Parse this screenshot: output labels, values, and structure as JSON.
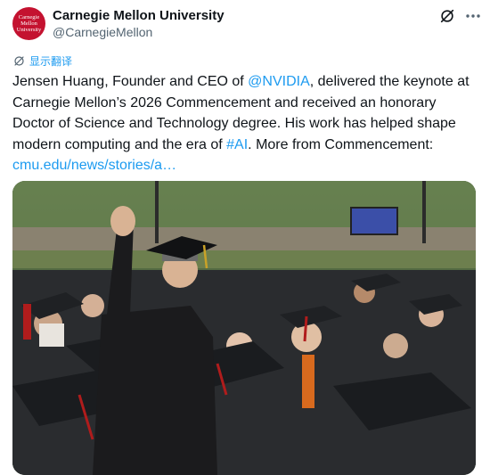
{
  "account": {
    "avatar_lines": [
      "Carnegie",
      "Mellon",
      "University"
    ],
    "display_name": "Carnegie Mellon University",
    "handle": "@CarnegieMellon"
  },
  "translate": {
    "label": "显示翻译"
  },
  "tweet": {
    "seg1": "Jensen Huang, Founder and CEO of ",
    "mention": "@NVIDIA",
    "seg2": ", delivered the keynote at Carnegie Mellon’s 2026 Commencement and received an honorary Doctor of Science and Technology degree. His work has helped shape modern computing and the era of ",
    "hashtag": "#AI",
    "seg3": ". More from Commencement:",
    "link": "cmu.edu/news/stories/a…"
  },
  "colors": {
    "accent": "#1d9bf0",
    "brand": "#c41230",
    "text": "#0f1419",
    "muted": "#536471"
  },
  "icons": {
    "grok": "grok-icon",
    "more": "more-icon",
    "translate": "translate-icon"
  }
}
